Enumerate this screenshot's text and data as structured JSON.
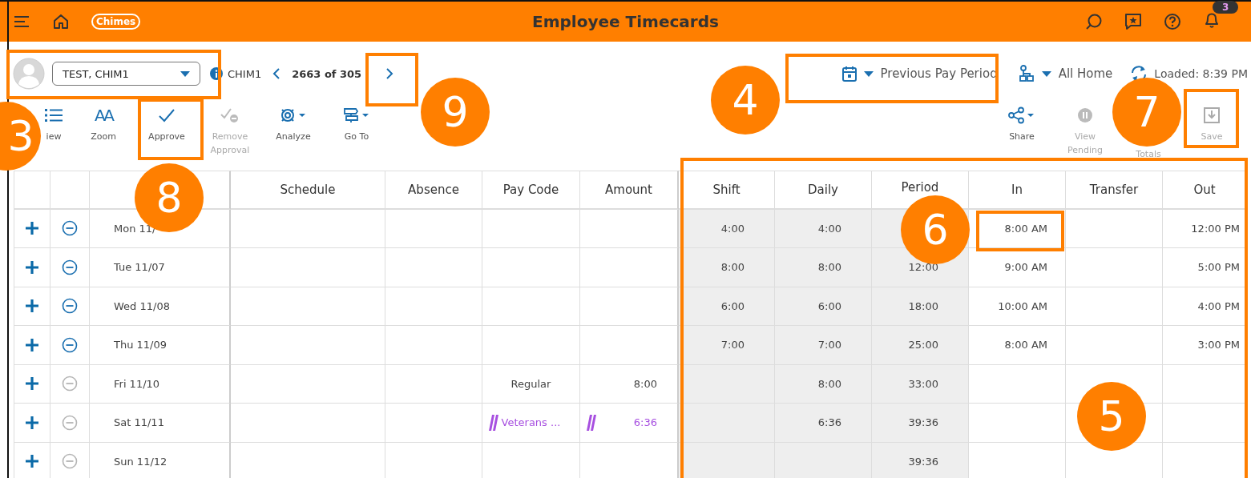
{
  "header": {
    "title": "Employee Timecards",
    "logo": "Chimes",
    "notification_count": "3"
  },
  "employee": {
    "name": "TEST, CHIM1",
    "id": "CHIM1",
    "position": "2663 of 305"
  },
  "filters": {
    "period": "Previous Pay Period",
    "location": "All Home",
    "loaded": "Loaded: 8:39 PM"
  },
  "toolbar_left": [
    {
      "label": "iew",
      "disabled": false
    },
    {
      "label": "Zoom",
      "glyph": "AA",
      "disabled": false
    },
    {
      "label": "Approve",
      "disabled": false
    },
    {
      "label": "Remove Approval",
      "disabled": true
    },
    {
      "label": "Analyze",
      "disabled": false
    },
    {
      "label": "Go To",
      "disabled": false
    }
  ],
  "toolbar_right": [
    {
      "label": "Share",
      "disabled": false
    },
    {
      "label": "View Pending",
      "disabled": true
    },
    {
      "label": "Totals",
      "disabled": true
    },
    {
      "label": "Save",
      "disabled": true
    }
  ],
  "table": {
    "columns": [
      "Schedule",
      "Absence",
      "Pay Code",
      "Amount",
      "Shift",
      "Daily",
      "Period",
      "In",
      "Transfer",
      "Out"
    ],
    "rows": [
      {
        "date": "Mon 11/",
        "remove_enabled": true,
        "schedule": "",
        "absence": "",
        "pay_code": "",
        "amount": "",
        "kind": "plain",
        "shift": "4:00",
        "daily": "4:00",
        "period": "",
        "in": "8:00 AM",
        "transfer": "",
        "out": "12:00 PM"
      },
      {
        "date": "Tue 11/07",
        "remove_enabled": true,
        "schedule": "",
        "absence": "",
        "pay_code": "",
        "amount": "",
        "kind": "plain",
        "shift": "8:00",
        "daily": "8:00",
        "period": "12:00",
        "in": "9:00 AM",
        "transfer": "",
        "out": "5:00 PM"
      },
      {
        "date": "Wed 11/08",
        "remove_enabled": true,
        "schedule": "",
        "absence": "",
        "pay_code": "",
        "amount": "",
        "kind": "plain",
        "shift": "6:00",
        "daily": "6:00",
        "period": "18:00",
        "in": "10:00 AM",
        "transfer": "",
        "out": "4:00 PM"
      },
      {
        "date": "Thu 11/09",
        "remove_enabled": true,
        "schedule": "",
        "absence": "",
        "pay_code": "",
        "amount": "",
        "kind": "plain",
        "shift": "7:00",
        "daily": "7:00",
        "period": "25:00",
        "in": "8:00 AM",
        "transfer": "",
        "out": "3:00 PM"
      },
      {
        "date": "Fri 11/10",
        "remove_enabled": false,
        "schedule": "",
        "absence": "",
        "pay_code": "Regular",
        "amount": "8:00",
        "kind": "plain",
        "shift": "",
        "daily": "8:00",
        "period": "33:00",
        "in": "",
        "transfer": "",
        "out": ""
      },
      {
        "date": "Sat 11/11",
        "remove_enabled": false,
        "schedule": "",
        "absence": "",
        "pay_code": "Veterans ...",
        "amount": "6:36",
        "kind": "override",
        "shift": "",
        "daily": "6:36",
        "period": "39:36",
        "in": "",
        "transfer": "",
        "out": ""
      },
      {
        "date": "Sun 11/12",
        "remove_enabled": false,
        "schedule": "",
        "absence": "",
        "pay_code": "",
        "amount": "",
        "kind": "plain",
        "shift": "",
        "daily": "",
        "period": "39:36",
        "in": "",
        "transfer": "",
        "out": ""
      }
    ]
  },
  "callouts": [
    {
      "number": "3"
    },
    {
      "number": "9"
    },
    {
      "number": "8"
    },
    {
      "number": "4"
    },
    {
      "number": "7"
    },
    {
      "number": "6"
    },
    {
      "number": "5"
    }
  ]
}
